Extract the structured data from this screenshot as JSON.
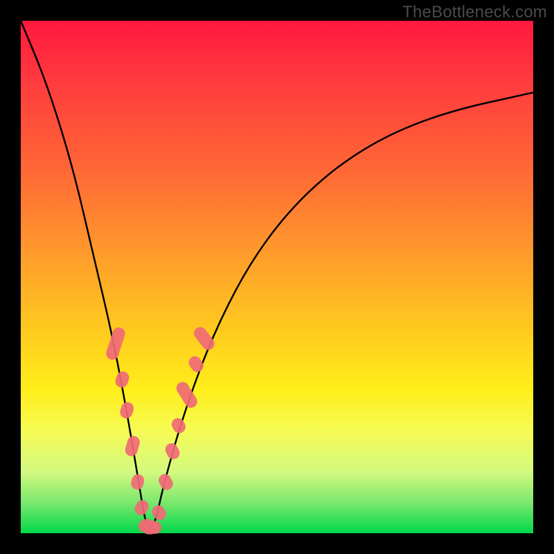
{
  "watermark": "TheBottleneck.com",
  "chart_data": {
    "type": "line",
    "title": "",
    "xlabel": "",
    "ylabel": "",
    "xlim": [
      0,
      100
    ],
    "ylim": [
      0,
      100
    ],
    "series": [
      {
        "name": "bottleneck-curve",
        "x": [
          0,
          5,
          10,
          14,
          18,
          21,
          23,
          24.5,
          26,
          28,
          32,
          38,
          46,
          56,
          68,
          82,
          100
        ],
        "values": [
          100,
          88,
          72,
          55,
          38,
          22,
          10,
          1,
          1,
          10,
          24,
          40,
          55,
          67,
          76,
          82,
          86
        ]
      }
    ],
    "markers": {
      "comment": "pink capsule-shaped markers clustered on the lower portions of both curve flanks",
      "color": "#f06a76",
      "points": [
        {
          "x": 18.5,
          "y": 37,
          "rot": -72,
          "len": 6.5
        },
        {
          "x": 19.8,
          "y": 30,
          "rot": -72,
          "len": 3.2
        },
        {
          "x": 20.7,
          "y": 24,
          "rot": -73,
          "len": 3.2
        },
        {
          "x": 21.8,
          "y": 17,
          "rot": -74,
          "len": 4.0
        },
        {
          "x": 22.8,
          "y": 10,
          "rot": -76,
          "len": 3.0
        },
        {
          "x": 23.6,
          "y": 5,
          "rot": -60,
          "len": 3.0
        },
        {
          "x": 24.4,
          "y": 1.5,
          "rot": -20,
          "len": 3.0
        },
        {
          "x": 25.2,
          "y": 1.0,
          "rot": 0,
          "len": 3.0
        },
        {
          "x": 26.0,
          "y": 1.2,
          "rot": 20,
          "len": 3.0
        },
        {
          "x": 27.0,
          "y": 4,
          "rot": 55,
          "len": 3.0
        },
        {
          "x": 28.3,
          "y": 10,
          "rot": 62,
          "len": 3.2
        },
        {
          "x": 29.6,
          "y": 16,
          "rot": 62,
          "len": 3.2
        },
        {
          "x": 30.8,
          "y": 21,
          "rot": 60,
          "len": 3.0
        },
        {
          "x": 32.4,
          "y": 27,
          "rot": 58,
          "len": 5.5
        },
        {
          "x": 34.2,
          "y": 33,
          "rot": 55,
          "len": 3.2
        },
        {
          "x": 35.8,
          "y": 38,
          "rot": 52,
          "len": 5.0
        }
      ]
    },
    "background_gradient": {
      "top": "#ff183f",
      "mid": "#ffee1a",
      "bottom": "#00d84a"
    }
  }
}
